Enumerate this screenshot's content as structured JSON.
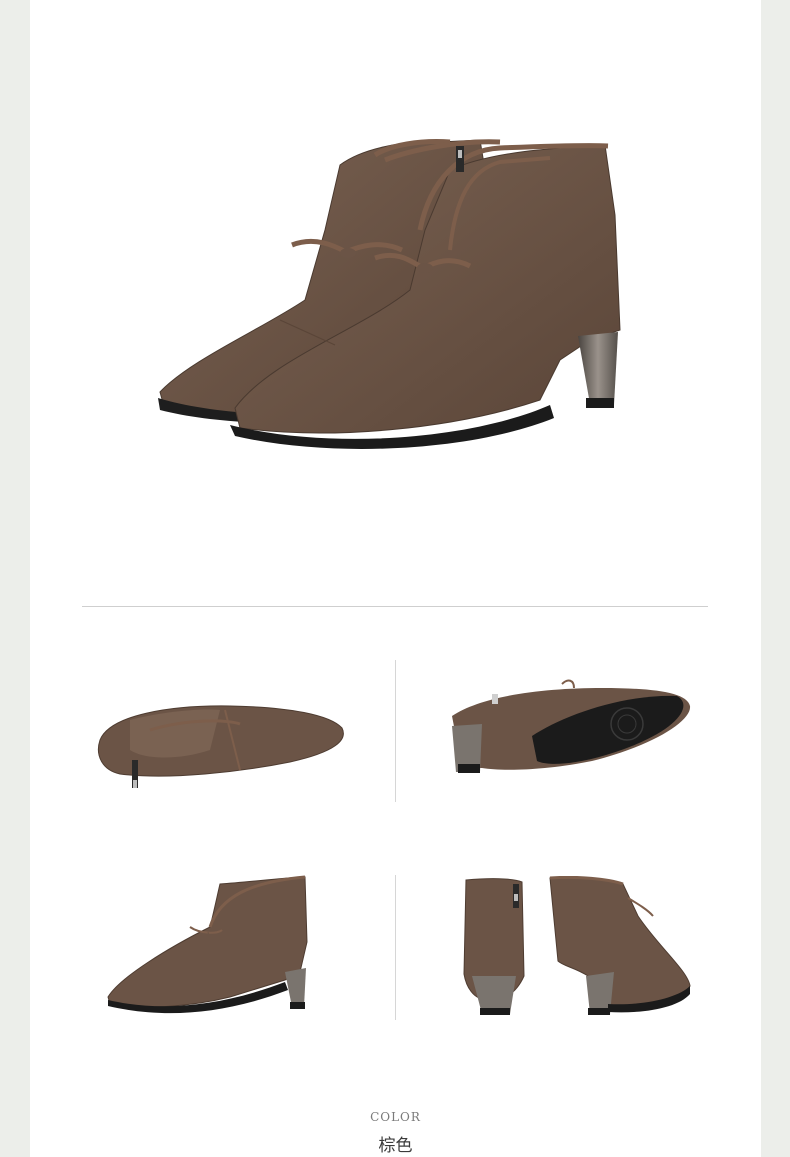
{
  "product": {
    "color_label": "COLOR",
    "color_name": "棕色",
    "suede_color": "#6b5446",
    "sole_color": "#1b1b1b",
    "heel_color": "#7a746e"
  },
  "views": [
    {
      "name": "hero-pair-view"
    },
    {
      "name": "top-view"
    },
    {
      "name": "sole-view"
    },
    {
      "name": "side-view"
    },
    {
      "name": "front-back-view"
    }
  ]
}
